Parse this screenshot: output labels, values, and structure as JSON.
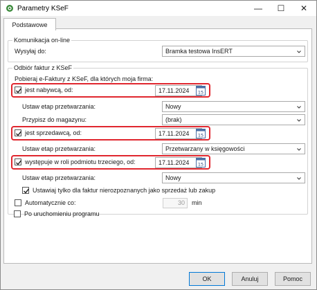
{
  "window": {
    "title": "Parametry KSeF",
    "controls": {
      "minimize": "—",
      "maximize": "☐",
      "close": "✕"
    }
  },
  "tabs": [
    {
      "label": "Podstawowe",
      "active": true
    }
  ],
  "online_group": {
    "legend": "Komunikacja on-line",
    "send_to_label": "Wysyłaj do:",
    "send_to_value": "Bramka testowa InsERT"
  },
  "receive_group": {
    "legend": "Odbiór faktur z KSeF",
    "intro": "Pobieraj e-Faktury z KSeF, dla których moja firma:",
    "buyer": {
      "label": "jest nabywcą, od:",
      "checked": true,
      "date": "17.11.2024",
      "stage_label": "Ustaw etap przetwarzania:",
      "stage_value": "Nowy",
      "warehouse_label": "Przypisz do magazynu:",
      "warehouse_value": "(brak)"
    },
    "seller": {
      "label": "jest sprzedawcą, od:",
      "checked": true,
      "date": "17.11.2024",
      "stage_label": "Ustaw etap przetwarzania:",
      "stage_value": "Przetwarzany w księgowości"
    },
    "third_party": {
      "label": "występuje w roli podmiotu trzeciego, od:",
      "checked": true,
      "date": "17.11.2024",
      "stage_label": "Ustaw etap przetwarzania:",
      "stage_value": "Nowy",
      "unrecognized_label": "Ustawiaj tylko dla faktur nierozpoznanych jako sprzedaż lub zakup",
      "unrecognized_checked": true
    },
    "auto": {
      "label": "Automatycznie co:",
      "checked": false,
      "minutes": "30",
      "unit": "min"
    },
    "on_start": {
      "label": "Po uruchomieniu programu",
      "checked": false
    }
  },
  "buttons": {
    "ok": "OK",
    "cancel": "Anuluj",
    "help": "Pomoc"
  },
  "colors": {
    "highlight": "#e0262e",
    "accent": "#0078d7"
  }
}
